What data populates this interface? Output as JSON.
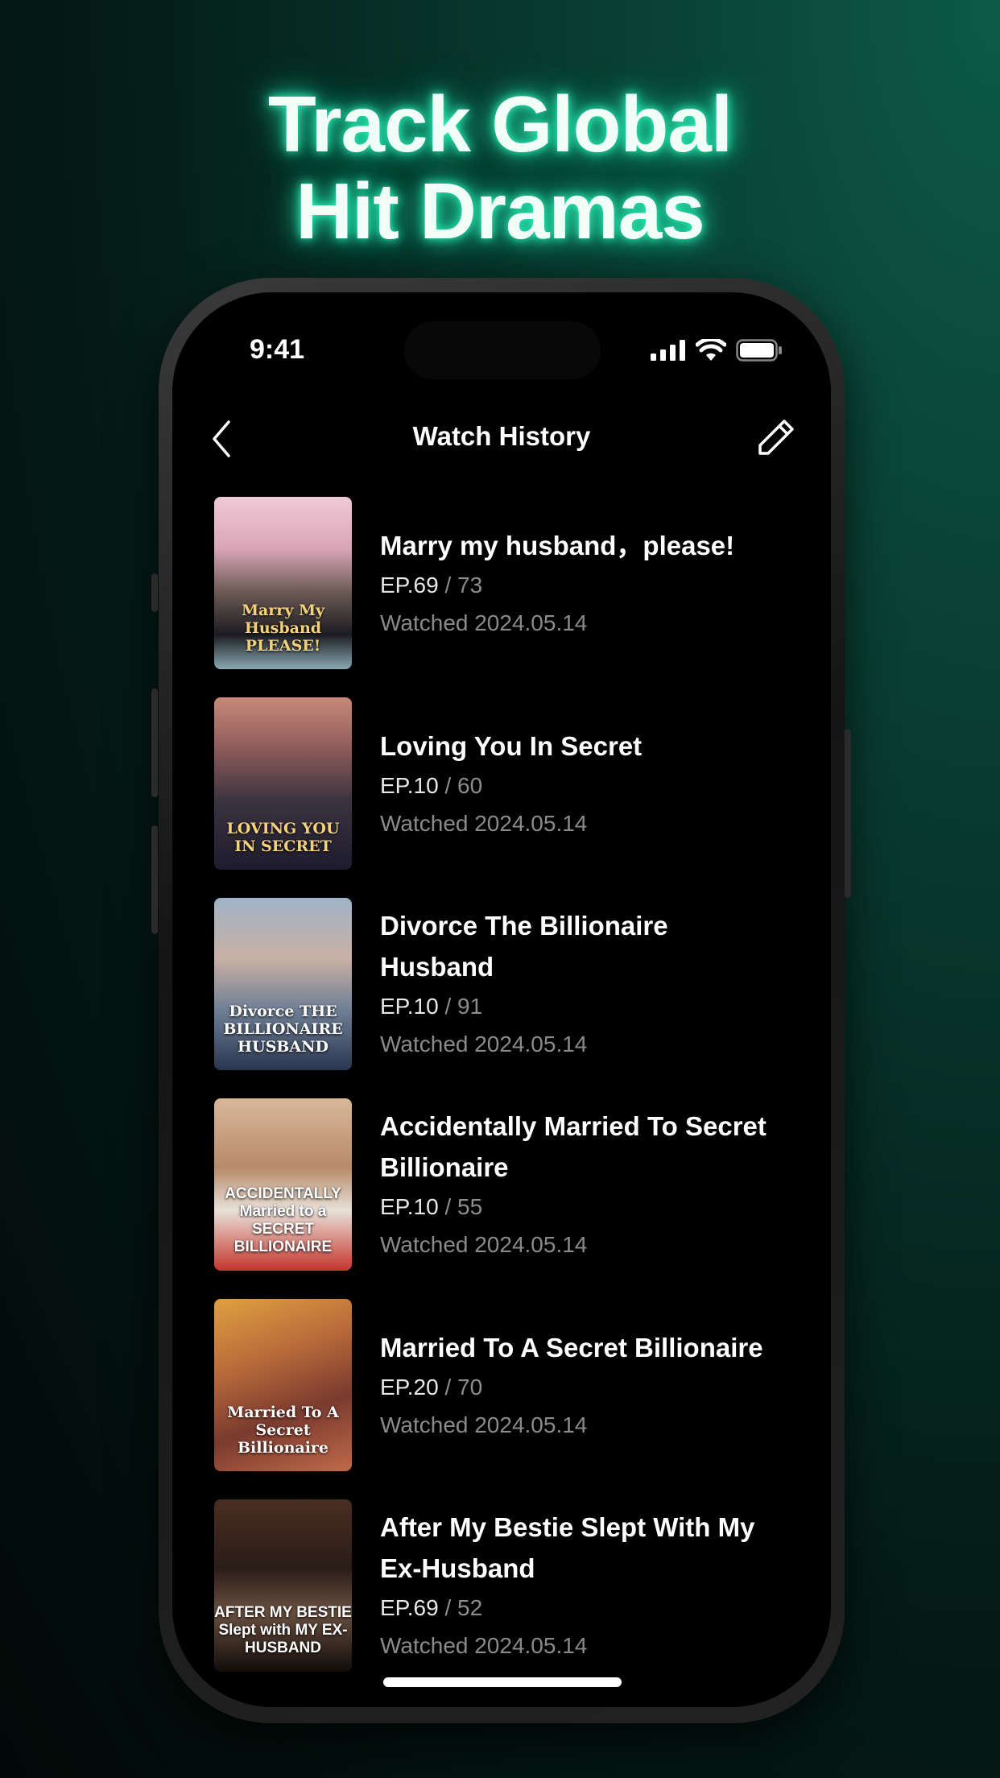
{
  "headline": {
    "line1": "Track Global",
    "line2": "Hit Dramas"
  },
  "status_bar": {
    "time": "9:41",
    "icons": [
      "signal-icon",
      "wifi-icon",
      "battery-icon"
    ]
  },
  "nav": {
    "title": "Watch History",
    "back_icon": "chevron-left-icon",
    "edit_icon": "pencil-icon"
  },
  "items": [
    {
      "title": "Marry my husband，please!",
      "ep": "EP.69",
      "total": " / 73",
      "watched": "Watched 2024.05.14",
      "poster_text": "Marry My Husband PLEASE!"
    },
    {
      "title": "Loving You In Secret",
      "ep": "EP.10",
      "total": " / 60",
      "watched": "Watched 2024.05.14",
      "poster_text": "LOVING YOU IN SECRET"
    },
    {
      "title": "Divorce The Billionaire Husband",
      "ep": "EP.10",
      "total": " / 91",
      "watched": "Watched 2024.05.14",
      "poster_text": "Divorce THE BILLIONAIRE HUSBAND"
    },
    {
      "title": "Accidentally Married To Secret Billionaire",
      "ep": "EP.10",
      "total": " / 55",
      "watched": "Watched 2024.05.14",
      "poster_text": "ACCIDENTALLY Married to a SECRET BILLIONAIRE"
    },
    {
      "title": "Married To A Secret Billionaire",
      "ep": "EP.20",
      "total": " / 70",
      "watched": "Watched 2024.05.14",
      "poster_text": "Married To A Secret Billionaire"
    },
    {
      "title": "After My Bestie Slept With My Ex-Husband",
      "ep": "EP.69",
      "total": " / 52",
      "watched": "Watched 2024.05.14",
      "poster_text": "AFTER MY BESTIE Slept with MY EX-HUSBAND"
    }
  ],
  "colors": {
    "accent_glow": "#2effc0",
    "background": "#000000",
    "muted_text": "#8a8a8a"
  }
}
